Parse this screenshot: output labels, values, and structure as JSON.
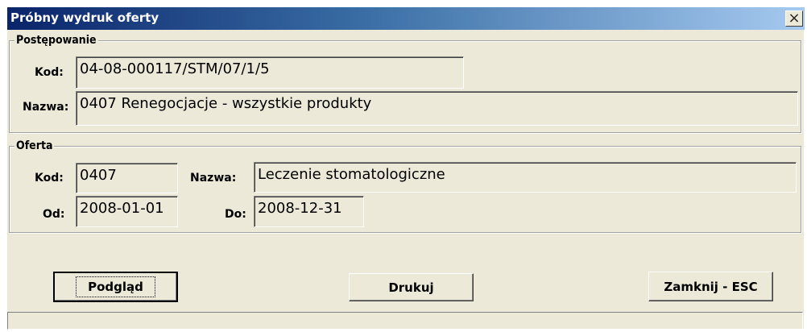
{
  "window": {
    "title": "Próbny wydruk oferty",
    "close_glyph": "×"
  },
  "postepowanie": {
    "legend": "Postępowanie",
    "kod_label": "Kod:",
    "kod_value": "04-08-000117/STM/07/1/5",
    "nazwa_label": "Nazwa:",
    "nazwa_value": "0407 Renegocjacje - wszystkie produkty"
  },
  "oferta": {
    "legend": "Oferta",
    "kod_label": "Kod:",
    "kod_value": "0407",
    "nazwa_label": "Nazwa:",
    "nazwa_value": "Leczenie stomatologiczne",
    "od_label": "Od:",
    "od_value": "2008-01-01",
    "do_label": "Do:",
    "do_value": "2008-12-31"
  },
  "buttons": {
    "preview": "Podgląd",
    "print": "Drukuj",
    "close": "Zamknij - ESC"
  }
}
